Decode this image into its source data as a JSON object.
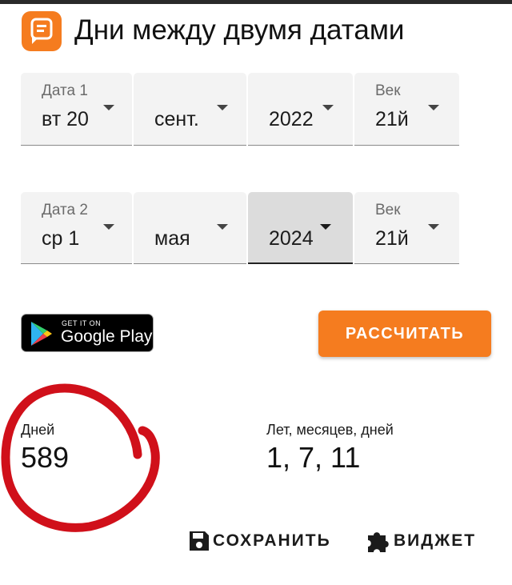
{
  "app": {
    "title": "Дни между двумя датами",
    "accent": "#f57c1f"
  },
  "date1": {
    "label": "Дата 1",
    "day": "вт 20",
    "month": "сент.",
    "year": "2022",
    "century_label": "Век",
    "century": "21й"
  },
  "date2": {
    "label": "Дата 2",
    "day": "ср 1",
    "month": "мая",
    "year": "2024",
    "century_label": "Век",
    "century": "21й"
  },
  "google_play": {
    "small": "GET IT ON",
    "big": "Google Play"
  },
  "calculate_label": "РАССЧИТАТЬ",
  "results": {
    "days_label": "Дней",
    "days_value": "589",
    "ymd_label": "Лет, месяцев, дней",
    "ymd_value": "1, 7, 11"
  },
  "actions": {
    "save": "СОХРАНИТЬ",
    "widget": "ВИДЖЕТ"
  },
  "icons": {
    "app": "calendar-app-icon",
    "save": "floppy-disk-icon",
    "widget": "puzzle-piece-icon",
    "caret": "dropdown-caret-icon"
  },
  "annotation_color": "#d0101a"
}
